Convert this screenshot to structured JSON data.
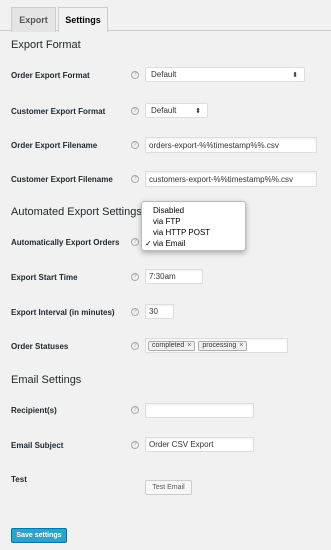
{
  "tabs": [
    {
      "label": "Export"
    },
    {
      "label": "Settings"
    }
  ],
  "export_format": {
    "title": "Export Format",
    "order_format": {
      "label": "Order Export Format",
      "value": "Default"
    },
    "customer_format": {
      "label": "Customer Export Format",
      "value": "Default"
    },
    "order_filename": {
      "label": "Order Export Filename",
      "value": "orders-export-%%timestamp%%.csv"
    },
    "customer_filename": {
      "label": "Customer Export Filename",
      "value": "customers-export-%%timestamp%%.csv"
    }
  },
  "automated": {
    "title": "Automated Export Settings",
    "auto_export": {
      "label": "Automatically Export Orders",
      "options": [
        "Disabled",
        "via FTP",
        "via HTTP POST",
        "via Email"
      ],
      "selected": "via Email",
      "check": "✓"
    },
    "start_time": {
      "label": "Export Start Time",
      "value": "7:30am"
    },
    "interval": {
      "label": "Export Interval (in minutes)",
      "value": "30"
    },
    "statuses": {
      "label": "Order Statuses",
      "tags": [
        "completed",
        "processing"
      ],
      "remove": "×"
    }
  },
  "email": {
    "title": "Email Settings",
    "recipients": {
      "label": "Recipient(s)",
      "value": ""
    },
    "subject": {
      "label": "Email Subject",
      "value": "Order CSV Export"
    },
    "test": {
      "label": "Test",
      "button": "Test Email"
    }
  },
  "save_button": "Save settings",
  "help_glyph": "?",
  "select_arrow": "⬍",
  "colors": {
    "primary": "#2ea2cc",
    "background": "#f1f1f1"
  }
}
